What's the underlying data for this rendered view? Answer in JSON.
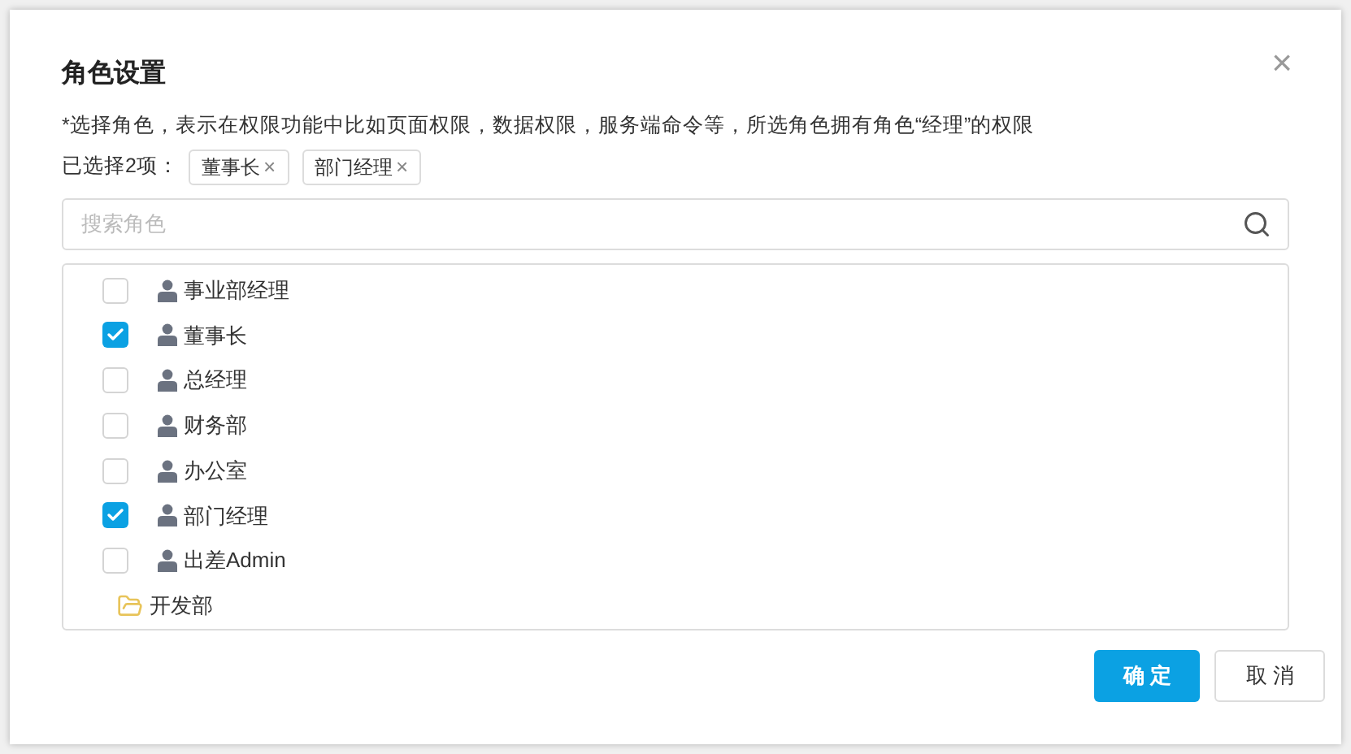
{
  "dialog": {
    "title": "角色设置",
    "close": "×",
    "description": "*选择角色，表示在权限功能中比如页面权限，数据权限，服务端命令等，所选角色拥有角色“经理”的权限",
    "selected_label": "已选择2项：",
    "selected_tags": [
      {
        "label": "董事长",
        "remove": "×"
      },
      {
        "label": "部门经理",
        "remove": "×"
      }
    ],
    "search": {
      "placeholder": "搜索角色"
    },
    "items": [
      {
        "kind": "role",
        "label": "事业部经理",
        "checked": false
      },
      {
        "kind": "role",
        "label": "董事长",
        "checked": true
      },
      {
        "kind": "role",
        "label": "总经理",
        "checked": false
      },
      {
        "kind": "role",
        "label": "财务部",
        "checked": false
      },
      {
        "kind": "role",
        "label": "办公室",
        "checked": false
      },
      {
        "kind": "role",
        "label": "部门经理",
        "checked": true
      },
      {
        "kind": "role",
        "label": "出差Admin",
        "checked": false
      },
      {
        "kind": "folder",
        "label": "开发部"
      }
    ],
    "buttons": [
      {
        "kind": "primary",
        "label": "确 定"
      },
      {
        "kind": "default",
        "label": "取 消"
      }
    ]
  }
}
